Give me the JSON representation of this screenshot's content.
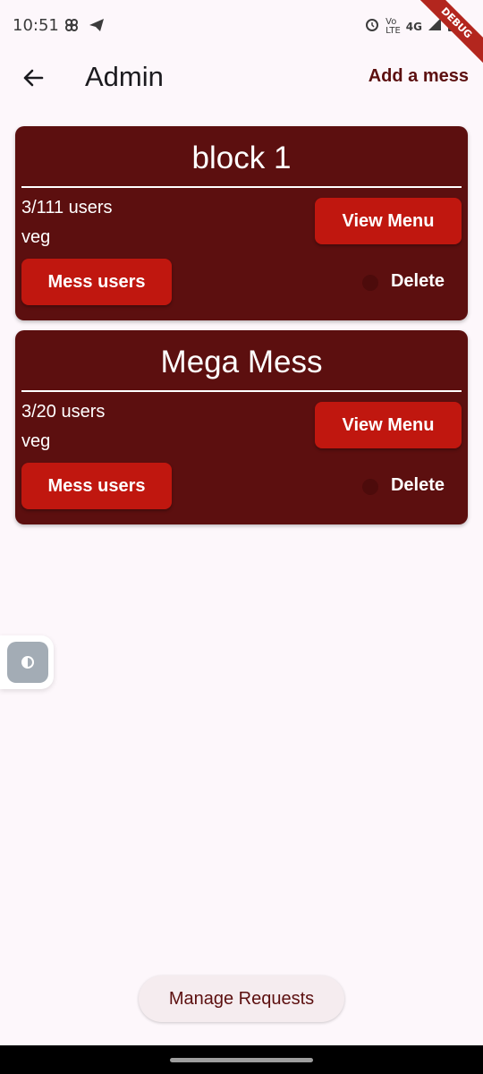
{
  "status_bar": {
    "time": "10:51",
    "net_top": "Vo",
    "net_bottom": "LTE",
    "network": "4G",
    "debug_label": "DEBUG",
    "left_icons": [
      "slack-icon",
      "telegram-icon"
    ],
    "right_icons": [
      "alarm-icon",
      "volte-icon",
      "signal-icon",
      "battery-icon"
    ]
  },
  "app_bar": {
    "title": "Admin",
    "action_label": "Add a mess"
  },
  "messes": [
    {
      "name": "block 1",
      "users": "3/111 users",
      "type": "veg",
      "view_menu_label": "View Menu",
      "mess_users_label": "Mess users",
      "delete_label": "Delete"
    },
    {
      "name": "Mega Mess",
      "users": "3/20 users",
      "type": "veg",
      "view_menu_label": "View Menu",
      "mess_users_label": "Mess users",
      "delete_label": "Delete"
    }
  ],
  "footer": {
    "manage_requests_label": "Manage Requests"
  },
  "colors": {
    "card_bg": "#5c0f0f",
    "button_red": "#c0170f",
    "page_bg": "#fdf7fb"
  }
}
